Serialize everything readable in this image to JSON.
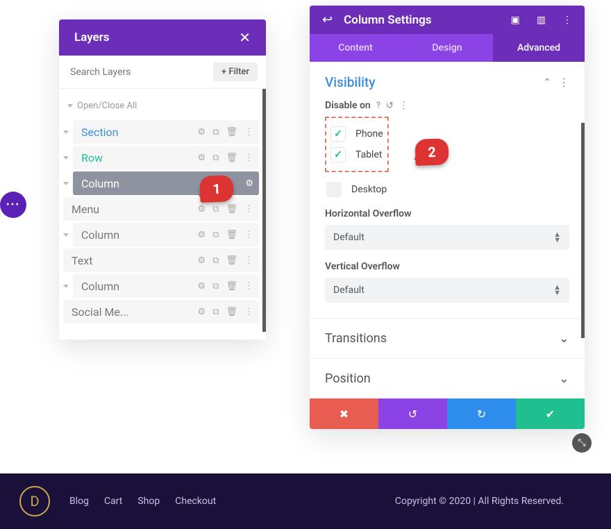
{
  "layers": {
    "title": "Layers",
    "search_placeholder": "Search Layers",
    "filter_label": "Filter",
    "open_close_all": "Open/Close All",
    "tree": {
      "section": "Section",
      "row": "Row",
      "col1": "Column",
      "menu": "Menu",
      "col2": "Column",
      "text": "Text",
      "col3": "Column",
      "social": "Social Me..."
    }
  },
  "callouts": {
    "one": "1",
    "two": "2"
  },
  "settings": {
    "title": "Column Settings",
    "tabs": {
      "content": "Content",
      "design": "Design",
      "advanced": "Advanced"
    },
    "visibility": {
      "title": "Visibility",
      "disable_on": "Disable on",
      "phone": "Phone",
      "tablet": "Tablet",
      "desktop": "Desktop",
      "horiz": "Horizontal Overflow",
      "horiz_value": "Default",
      "vert": "Vertical Overflow",
      "vert_value": "Default"
    },
    "transitions": "Transitions",
    "position": "Position"
  },
  "footer": {
    "links": {
      "blog": "Blog",
      "cart": "Cart",
      "shop": "Shop",
      "checkout": "Checkout"
    },
    "logo_letter": "D",
    "copyright": "Copyright © 2020 | All Rights Reserved."
  }
}
